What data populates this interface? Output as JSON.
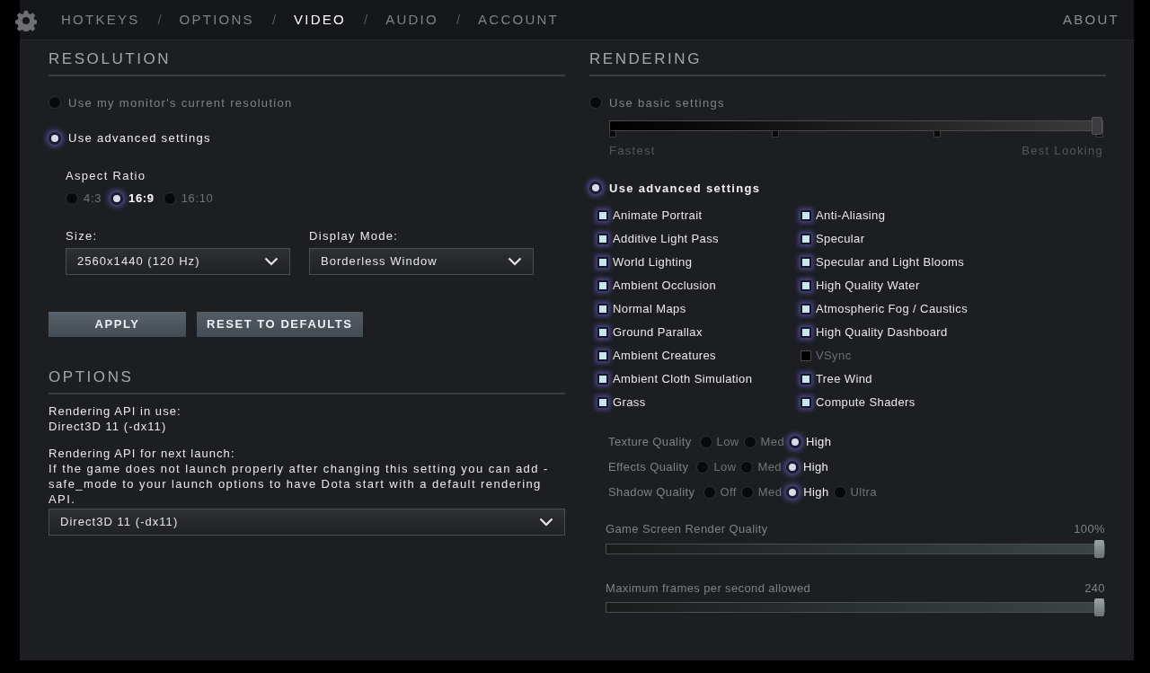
{
  "nav": {
    "tabs": [
      {
        "label": "HOTKEYS",
        "selected": false
      },
      {
        "label": "OPTIONS",
        "selected": false
      },
      {
        "label": "VIDEO",
        "selected": true
      },
      {
        "label": "AUDIO",
        "selected": false
      },
      {
        "label": "ACCOUNT",
        "selected": false
      }
    ],
    "separator": "/",
    "about": "ABOUT"
  },
  "resolution": {
    "title": "RESOLUTION",
    "modes": [
      {
        "label": "Use my monitor's current resolution",
        "selected": false
      },
      {
        "label": "Use advanced settings",
        "selected": true
      }
    ],
    "aspect_ratio": {
      "label": "Aspect Ratio",
      "options": [
        {
          "label": "4:3",
          "selected": false
        },
        {
          "label": "16:9",
          "selected": true
        },
        {
          "label": "16:10",
          "selected": false
        }
      ]
    },
    "size": {
      "label": "Size:",
      "value": "2560x1440 (120 Hz)"
    },
    "display_mode": {
      "label": "Display Mode:",
      "value": "Borderless Window"
    },
    "buttons": [
      "APPLY",
      "RESET TO DEFAULTS"
    ]
  },
  "options": {
    "title": "OPTIONS",
    "api_in_use_label": "Rendering API in use:",
    "api_in_use": "Direct3D 11 (-dx11)",
    "next_launch_label": "Rendering API for next launch:",
    "note": "If the game does not launch properly after changing this setting you can add -safe_mode to your launch options to have Dota start with a default rendering API.",
    "api_select": "Direct3D 11 (-dx11)"
  },
  "rendering": {
    "title": "RENDERING",
    "basic": {
      "label": "Use basic settings",
      "selected": false,
      "level": 1,
      "min_label": "Fastest",
      "max_label": "Best Looking"
    },
    "advanced": {
      "label": "Use advanced settings",
      "selected": true
    },
    "feature_columns": [
      [
        {
          "label": "Animate Portrait",
          "checked": true
        },
        {
          "label": "Additive Light Pass",
          "checked": true
        },
        {
          "label": "World Lighting",
          "checked": true
        },
        {
          "label": "Ambient Occlusion",
          "checked": true
        },
        {
          "label": "Normal Maps",
          "checked": true
        },
        {
          "label": "Ground Parallax",
          "checked": true
        },
        {
          "label": "Ambient Creatures",
          "checked": true
        },
        {
          "label": "Ambient Cloth Simulation",
          "checked": true
        },
        {
          "label": "Grass",
          "checked": true
        }
      ],
      [
        {
          "label": "Anti-Aliasing",
          "checked": true
        },
        {
          "label": "Specular",
          "checked": true
        },
        {
          "label": "Specular and Light Blooms",
          "checked": true
        },
        {
          "label": "High Quality Water",
          "checked": true
        },
        {
          "label": "Atmospheric Fog / Caustics",
          "checked": true
        },
        {
          "label": "High Quality Dashboard",
          "checked": true
        },
        {
          "label": "VSync",
          "checked": false
        },
        {
          "label": "Tree Wind",
          "checked": true
        },
        {
          "label": "Compute Shaders",
          "checked": true
        }
      ]
    ],
    "quality": [
      {
        "label": "Texture Quality",
        "options": [
          {
            "label": "Low",
            "selected": false
          },
          {
            "label": "Med",
            "selected": false
          },
          {
            "label": "High",
            "selected": true
          }
        ]
      },
      {
        "label": "Effects Quality",
        "options": [
          {
            "label": "Low",
            "selected": false
          },
          {
            "label": "Med",
            "selected": false
          },
          {
            "label": "High",
            "selected": true
          }
        ]
      },
      {
        "label": "Shadow Quality",
        "options": [
          {
            "label": "Off",
            "selected": false
          },
          {
            "label": "Med",
            "selected": false
          },
          {
            "label": "High",
            "selected": true
          },
          {
            "label": "Ultra",
            "selected": false
          }
        ]
      }
    ],
    "sliders": [
      {
        "label": "Game Screen Render Quality",
        "reading": "100%",
        "level": 1
      },
      {
        "label": "Maximum frames per second allowed",
        "reading": "240",
        "level": 1
      }
    ]
  }
}
